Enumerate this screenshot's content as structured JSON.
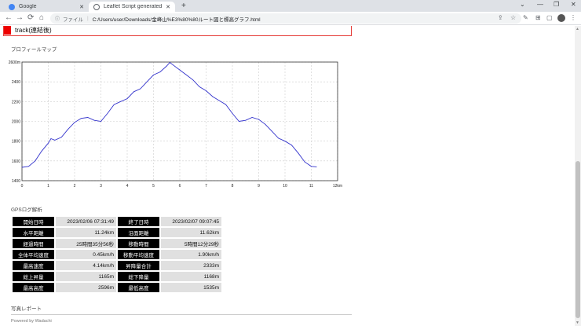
{
  "browser": {
    "tabs": [
      {
        "label": "Google",
        "close": "✕",
        "icon_color": "#4285f4"
      },
      {
        "label": "Leaflet Script generated by Wadachi",
        "close": "✕",
        "icon_color": "#5f6368"
      }
    ],
    "new_tab": "+",
    "window_controls": [
      "⌄",
      "—",
      "❐",
      "✕"
    ],
    "nav": {
      "back": "←",
      "forward": "→",
      "reload": "⟳",
      "home": "⌂"
    },
    "address": {
      "site_label": "ファイル",
      "separator": "|",
      "url": "C:/Users/user/Downloads/金峰山%E3%80%80ルート図と標高グラフ.html"
    },
    "toolbar_icons": [
      "⇪",
      "☆",
      "✎",
      "⊞",
      "▢"
    ]
  },
  "page": {
    "track_name": "track(連結後)",
    "track_color": "#e00000",
    "profile_title": "プロフィールマップ",
    "gps_title": "GPSログ解析",
    "photo_title": "写真レポート",
    "footer": "Powered by Wadachi"
  },
  "chart_data": {
    "type": "line",
    "title": "",
    "xlabel": "",
    "ylabel": "",
    "x_unit": "12km",
    "y_unit": "2600m",
    "xlim": [
      0,
      12
    ],
    "ylim": [
      1400,
      2600
    ],
    "x_ticks": [
      "0",
      "1",
      "2",
      "3",
      "4",
      "5",
      "6",
      "7",
      "8",
      "9",
      "10",
      "11",
      "12km"
    ],
    "y_ticks": [
      "1400",
      "1600",
      "1800",
      "2000",
      "2200",
      "2400",
      "2600m"
    ],
    "grid": true,
    "line_color": "#3333cc",
    "x": [
      0,
      0.25,
      0.5,
      0.75,
      1.0,
      1.1,
      1.25,
      1.5,
      1.75,
      2.0,
      2.25,
      2.5,
      2.75,
      3.0,
      3.25,
      3.5,
      3.75,
      4.0,
      4.25,
      4.5,
      4.75,
      5.0,
      5.25,
      5.5,
      5.62,
      5.75,
      6.0,
      6.25,
      6.5,
      6.75,
      7.0,
      7.25,
      7.5,
      7.75,
      8.0,
      8.25,
      8.5,
      8.75,
      9.0,
      9.25,
      9.5,
      9.75,
      10.0,
      10.25,
      10.5,
      10.75,
      11.0,
      11.2
    ],
    "y": [
      1535,
      1545,
      1600,
      1700,
      1780,
      1825,
      1810,
      1840,
      1920,
      1990,
      2030,
      2040,
      2010,
      2000,
      2080,
      2170,
      2200,
      2230,
      2300,
      2330,
      2400,
      2470,
      2500,
      2560,
      2596,
      2570,
      2520,
      2470,
      2420,
      2350,
      2310,
      2250,
      2210,
      2170,
      2080,
      2000,
      2010,
      2040,
      2020,
      1970,
      1900,
      1830,
      1800,
      1760,
      1680,
      1590,
      1545,
      1540
    ]
  },
  "gps": {
    "rows": [
      [
        {
          "k": "開始日時",
          "v": "2023/02/06 07:31:49"
        },
        {
          "k": "終了日時",
          "v": "2023/02/07 09:07:45"
        }
      ],
      [
        {
          "k": "水平距離",
          "v": "11.24km"
        },
        {
          "k": "沿面距離",
          "v": "11.62km"
        }
      ],
      [
        {
          "k": "経過時間",
          "v": "25時間35分56秒"
        },
        {
          "k": "移動時間",
          "v": "5時間12分29秒"
        }
      ],
      [
        {
          "k": "全体平均速度",
          "v": "0.45km/h"
        },
        {
          "k": "移動平均速度",
          "v": "1.90km/h"
        }
      ],
      [
        {
          "k": "最高速度",
          "v": "4.14km/h"
        },
        {
          "k": "昇降量合計",
          "v": "2333m"
        }
      ],
      [
        {
          "k": "総上昇量",
          "v": "1165m"
        },
        {
          "k": "総下降量",
          "v": "1168m"
        }
      ],
      [
        {
          "k": "最高高度",
          "v": "2596m"
        },
        {
          "k": "最低高度",
          "v": "1535m"
        }
      ]
    ]
  }
}
